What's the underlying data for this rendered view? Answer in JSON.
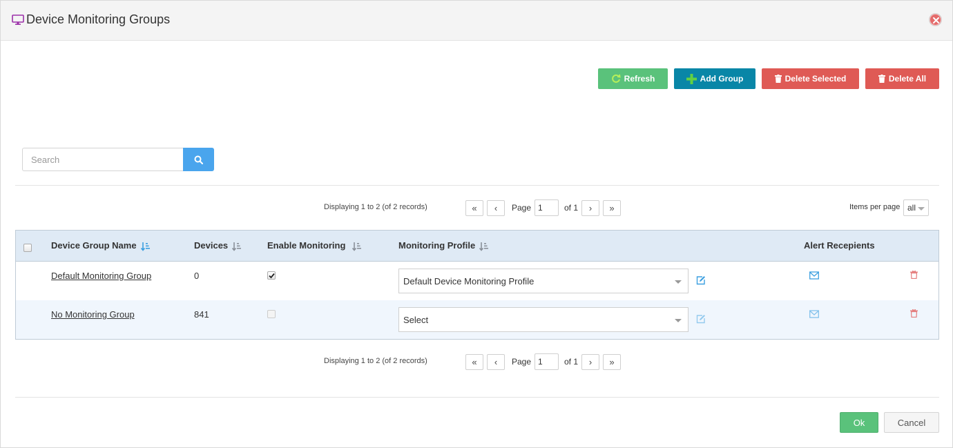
{
  "window": {
    "title": "Device Monitoring Groups",
    "icon": "monitor-icon",
    "close_icon": "close-icon"
  },
  "toolbar": {
    "refresh_label": "Refresh",
    "add_group_label": "Add Group",
    "delete_selected_label": "Delete Selected",
    "delete_all_label": "Delete All"
  },
  "search": {
    "placeholder": "Search",
    "value": ""
  },
  "pager_top": {
    "display_text": "Displaying 1 to 2 (of 2 records)",
    "page_label": "Page",
    "page_value": "1",
    "of_label": "of 1"
  },
  "pager_bottom": {
    "display_text": "Displaying 1 to 2 (of 2 records)",
    "page_label": "Page",
    "page_value": "1",
    "of_label": "of 1"
  },
  "items_per_page": {
    "label": "Items per page",
    "value": "all"
  },
  "grid": {
    "columns": [
      "Device Group Name",
      "Devices",
      "Enable Monitoring",
      "Monitoring Profile",
      "Alert Recepients"
    ],
    "rows": [
      {
        "name": "Default Monitoring Group",
        "devices": "0",
        "monitoring_enabled": true,
        "profile": "Default Device Monitoring Profile"
      },
      {
        "name": "No Monitoring Group",
        "devices": "841",
        "monitoring_enabled": false,
        "profile": "Select"
      }
    ]
  },
  "footer": {
    "ok_label": "Ok",
    "cancel_label": "Cancel"
  },
  "colors": {
    "refresh": "#5ac27b",
    "add_group": "#0986a7",
    "delete": "#df5a55",
    "search_button": "#4aa5ed",
    "header_bg": "#dfeaf5",
    "accent_icon": "#3b9fe0"
  }
}
